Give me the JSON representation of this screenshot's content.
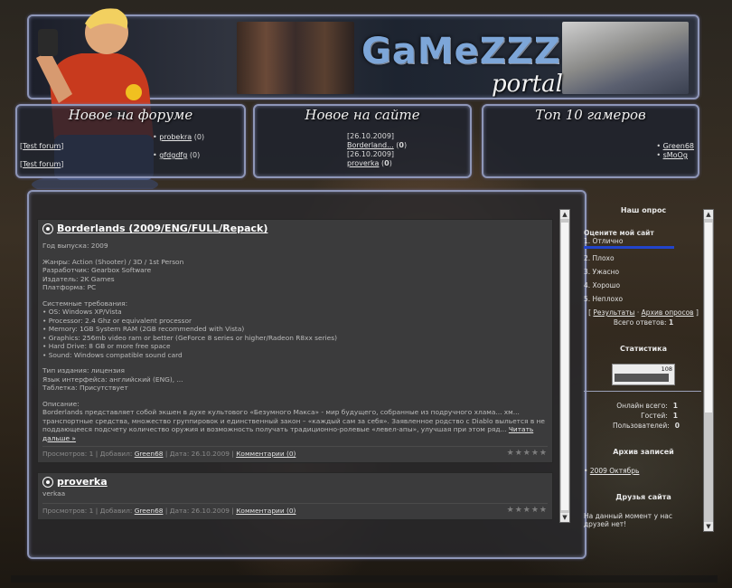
{
  "header": {
    "logo_main": "GaMeZZZ",
    "logo_sub": "portal"
  },
  "blocks": {
    "forum": {
      "title": "Новое на форуме",
      "rows": [
        {
          "left": "Test forum",
          "right": "probekra",
          "count": "0"
        },
        {
          "left": "Test forum",
          "right": "gfdgdfg",
          "count": "0"
        }
      ]
    },
    "site": {
      "title": "Новое на сайте",
      "rows": [
        {
          "date": "[26.10.2009]",
          "link": "Borderland...",
          "count": "0"
        },
        {
          "date": "[26.10.2009]",
          "link": "proverka",
          "count": "0"
        }
      ]
    },
    "top": {
      "title": "Топ 10 гамеров",
      "users": [
        "Green68",
        "sMoOg"
      ]
    }
  },
  "posts": [
    {
      "title": "Borderlands (2009/ENG/FULL/Repack)",
      "body": [
        "Год выпуска: 2009",
        "Жанры: Action (Shooter) / 3D / 1st Person\nРазработчик: Gearbox Software\nИздатель: 2K Games\nПлатформа: PC",
        "Системные требования:\n• OS: Windows XP/Vista\n• Processor: 2.4 Ghz or equivalent processor\n• Memory: 1GB System RAM (2GB recommended with Vista)\n• Graphics: 256mb video ram or better (GeForce 8 series or higher/Radeon R8xx series)\n• Hard Drive: 8 GB or more free space\n• Sound: Windows compatible sound card",
        "Тип издания: лицензия\nЯзык интерфейса: английский (ENG), ...\nТаблетка: Присутствует",
        "Описание:\nBorderlands представляет собой экшен в духе культового «Безумного Макса» - мир будущего, собранные из подручного хлама... хм... транспортные средства, множество группировок и единственный закон – «каждый сам за себя». Заявленное родство с Diablo выльется в не поддающееся подсчету количество оружия и возможность получать традиционно-ролевые «левел-апы», улучшая при этом ряд..."
      ],
      "read_more": "Читать дальше »",
      "views_label": "Просмотров: 1",
      "added_label": "Добавил:",
      "author": "Green68",
      "date_label": "Дата: 26.10.2009",
      "comments": "Комментарии (0)"
    },
    {
      "title": "proverka",
      "body": [
        "verkaa"
      ],
      "views_label": "Просмотров: 1",
      "added_label": "Добавил:",
      "author": "Green68",
      "date_label": "Дата: 26.10.2009",
      "comments": "Комментарии (0)"
    }
  ],
  "sidebar": {
    "poll_title": "Наш опрос",
    "poll_question": "Оцените мой сайт",
    "poll_options": [
      "1. Отлично",
      "2. Плохо",
      "3. Ужасно",
      "4. Хорошо",
      "5. Неплохо"
    ],
    "poll_leading_fill": 1.0,
    "results": "Результаты",
    "archive": "Архив опросов",
    "total_votes_label": "Всего ответов:",
    "total_votes": "1",
    "stats_title": "Статистика",
    "counter_value": "108",
    "online_total_label": "Онлайн всего:",
    "online_total": "1",
    "guests_label": "Гостей:",
    "guests": "1",
    "users_label": "Пользователей:",
    "users": "0",
    "archive_title": "Архив записей",
    "archive_item": "2009 Октябрь",
    "friends_title": "Друзья сайта",
    "friends_text": "На данный момент у нас друзей нет!"
  },
  "colors": {
    "frame": "#8e96b8",
    "poll_bar": "#2244cc",
    "post_bg": "#3b3b3c"
  }
}
